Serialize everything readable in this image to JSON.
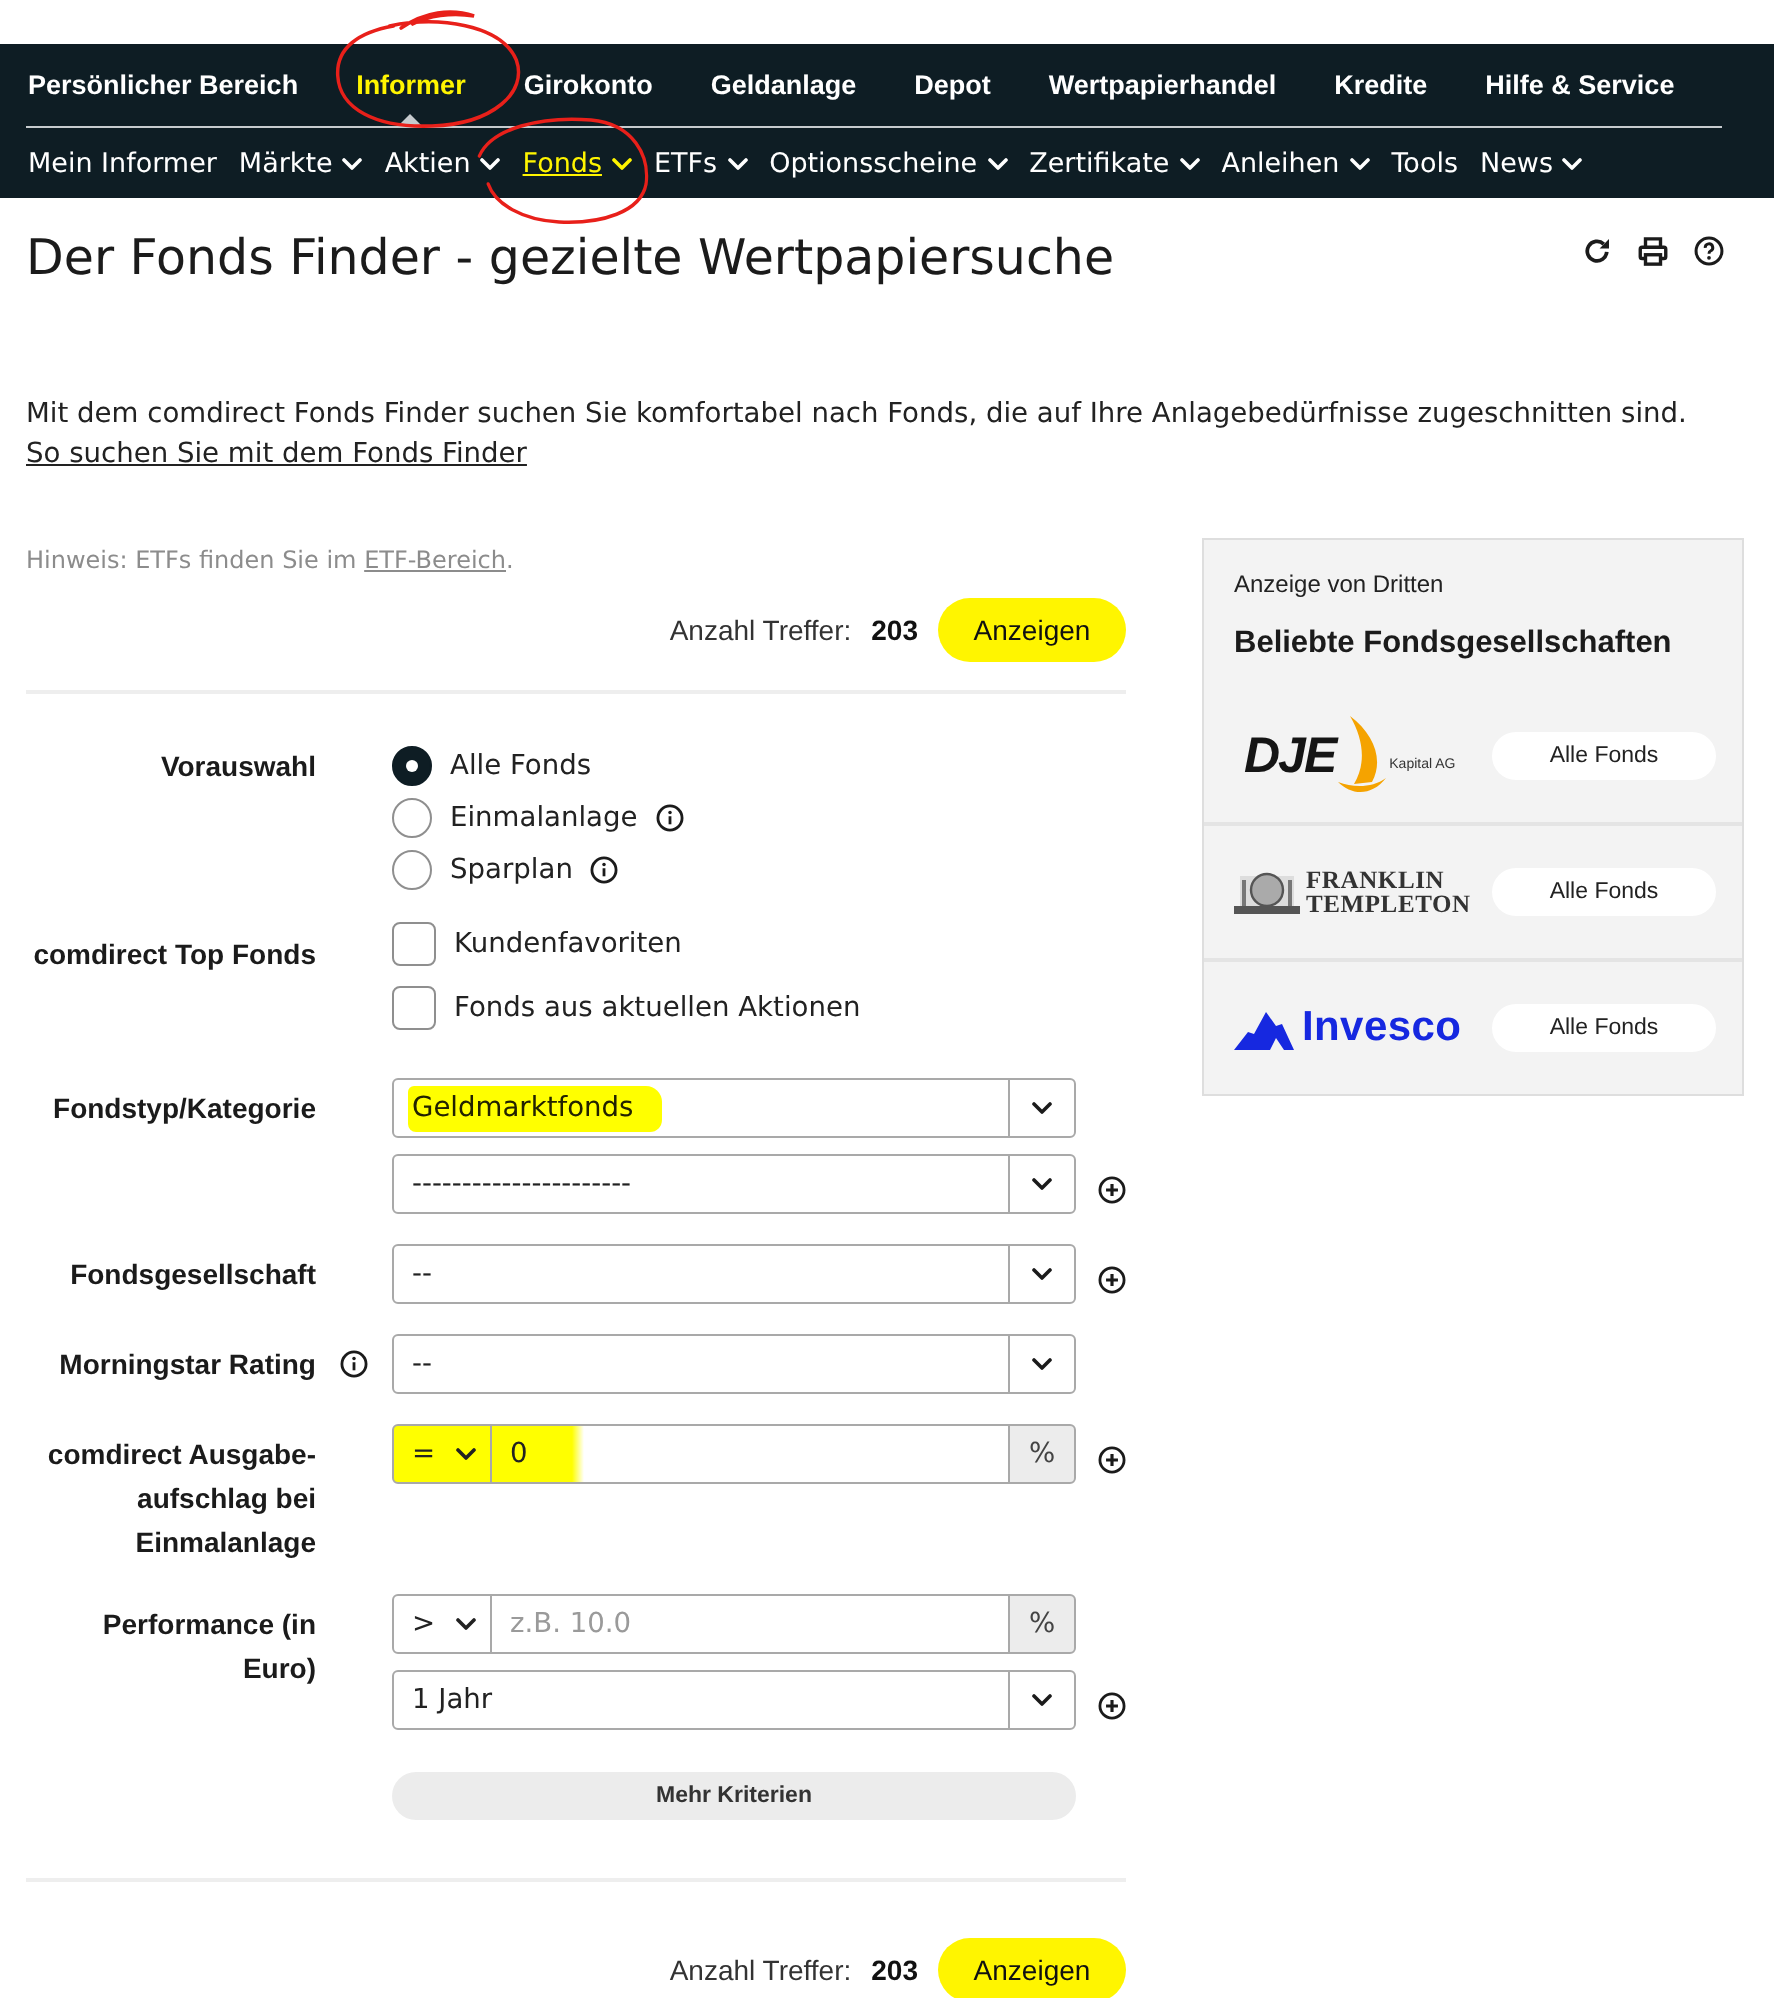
{
  "nav": {
    "main": [
      {
        "label": "Persönlicher Bereich",
        "selected": false,
        "circled": false
      },
      {
        "label": "Informer",
        "selected": true,
        "circled": true
      },
      {
        "label": "Girokonto",
        "selected": false,
        "circled": false
      },
      {
        "label": "Geldanlage",
        "selected": false,
        "circled": false
      },
      {
        "label": "Depot",
        "selected": false,
        "circled": false
      },
      {
        "label": "Wertpapierhandel",
        "selected": false,
        "circled": false
      },
      {
        "label": "Kredite",
        "selected": false,
        "circled": false
      },
      {
        "label": "Hilfe & Service",
        "selected": false,
        "circled": false
      }
    ],
    "sub": [
      {
        "label": "Mein Informer",
        "selected": false,
        "has_menu": false,
        "circled": false
      },
      {
        "label": "Märkte",
        "selected": false,
        "has_menu": true,
        "circled": false
      },
      {
        "label": "Aktien",
        "selected": false,
        "has_menu": true,
        "circled": false
      },
      {
        "label": "Fonds",
        "selected": true,
        "has_menu": true,
        "circled": true
      },
      {
        "label": "ETFs",
        "selected": false,
        "has_menu": true,
        "circled": false
      },
      {
        "label": "Optionsscheine",
        "selected": false,
        "has_menu": true,
        "circled": false
      },
      {
        "label": "Zertifikate",
        "selected": false,
        "has_menu": true,
        "circled": false
      },
      {
        "label": "Anleihen",
        "selected": false,
        "has_menu": true,
        "circled": false
      },
      {
        "label": "Tools",
        "selected": false,
        "has_menu": false,
        "circled": false
      },
      {
        "label": "News",
        "selected": false,
        "has_menu": true,
        "circled": false
      }
    ]
  },
  "header": {
    "title": "Der Fonds Finder - gezielte Wertpapiersuche"
  },
  "intro": {
    "text": "Mit dem comdirect Fonds Finder suchen Sie komfortabel nach Fonds, die auf Ihre Anlagebedürfnisse zugeschnitten sind.",
    "link": "So suchen Sie mit dem Fonds Finder"
  },
  "hint": {
    "text": "Hinweis: ETFs finden Sie im",
    "link": "ETF-Bereich",
    "suffix": "."
  },
  "results_top": {
    "label": "Anzahl Treffer:",
    "count": "203",
    "button": "Anzeigen"
  },
  "form": {
    "rows": [
      {
        "kind": "radios",
        "label": "Vorauswahl",
        "info": false,
        "options": [
          {
            "label": "Alle Fonds",
            "selected": true,
            "info": false
          },
          {
            "label": "Einmalanlage",
            "selected": false,
            "info": true
          },
          {
            "label": "Sparplan",
            "selected": false,
            "info": true
          }
        ]
      },
      {
        "kind": "checkboxes",
        "label": "comdirect Top Fonds",
        "info": false,
        "options": [
          {
            "label": "Kundenfavoriten",
            "checked": false
          },
          {
            "label": "Fonds aus aktuellen Aktionen",
            "checked": false
          }
        ]
      },
      {
        "kind": "fields",
        "label": "Fondstyp/Kategorie",
        "info": false,
        "fields": [
          {
            "kind": "select",
            "value": "Geldmarktfonds",
            "highlighted": true,
            "add": false
          },
          {
            "kind": "select",
            "value": "----------------------",
            "highlighted": false,
            "add": true
          }
        ]
      },
      {
        "kind": "fields",
        "label": "Fondsgesellschaft",
        "info": false,
        "fields": [
          {
            "kind": "select",
            "value": "--",
            "highlighted": false,
            "add": true
          }
        ]
      },
      {
        "kind": "fields",
        "label": "Morningstar Rating",
        "info": true,
        "fields": [
          {
            "kind": "select",
            "value": "--",
            "highlighted": false,
            "add": false
          }
        ]
      },
      {
        "kind": "fields",
        "label": "comdirect Ausgabe-aufschlag bei Einmalanlage",
        "info": false,
        "fields": [
          {
            "kind": "range",
            "operator": "=",
            "value": "0",
            "unit": "%",
            "highlighted": true,
            "add": true
          }
        ]
      },
      {
        "kind": "fields",
        "label": "Performance (in Euro)",
        "info": false,
        "fields": [
          {
            "kind": "range",
            "operator": ">",
            "placeholder": "z.B. 10.0",
            "unit": "%",
            "highlighted": false,
            "add": false
          },
          {
            "kind": "select",
            "value": "1 Jahr",
            "highlighted": false,
            "add": true
          }
        ]
      }
    ],
    "more_button": "Mehr Kriterien"
  },
  "results_bottom": {
    "label": "Anzahl Treffer:",
    "count": "203",
    "button": "Anzeigen"
  },
  "sidebar": {
    "label": "Anzeige von Dritten",
    "title": "Beliebte Fondsgesellschaften",
    "companies": [
      {
        "kind": "dje",
        "logo_text": "DJE",
        "logo_subtext": "Kapital AG",
        "button": "Alle Fonds"
      },
      {
        "kind": "franklin",
        "logo_text": "FRANKLIN",
        "logo_subtext": "TEMPLETON",
        "button": "Alle Fonds"
      },
      {
        "kind": "invesco",
        "logo_text": "Invesco",
        "button": "Alle Fonds"
      }
    ]
  }
}
